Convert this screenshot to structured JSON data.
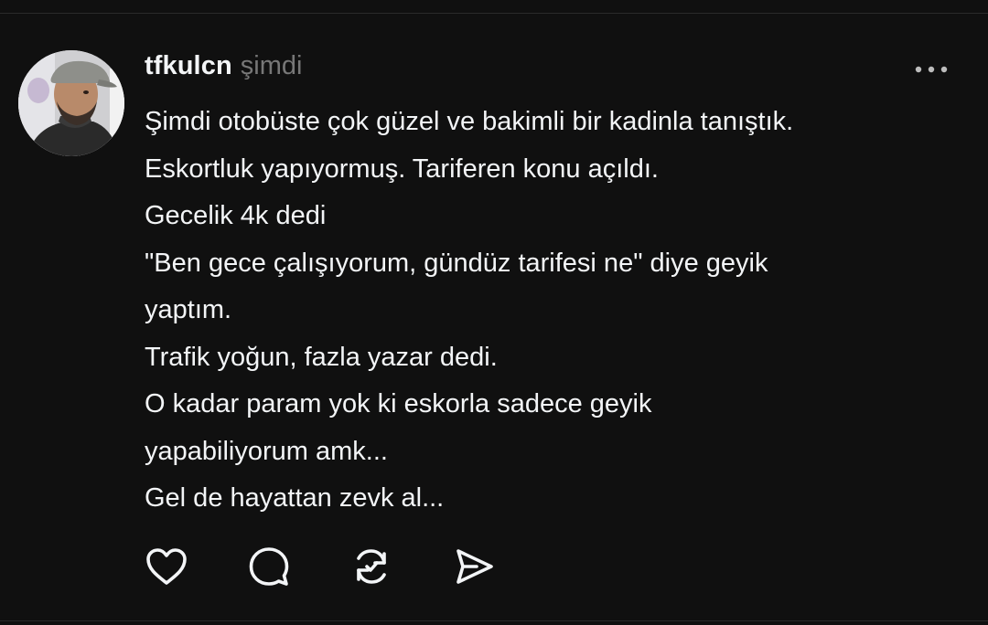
{
  "post": {
    "username": "tfkulcn",
    "timestamp": "şimdi",
    "lines": [
      "Şimdi otobüste çok güzel ve bakimli bir kadinla tanıştık.",
      "Eskortluk yapıyormuş. Tariferen konu açıldı.",
      "Gecelik 4k dedi",
      "\"Ben gece çalışıyorum, gündüz tarifesi ne\" diye geyik",
      "yaptım.",
      "Trafik yoğun, fazla yazar dedi.",
      "O kadar param yok ki eskorla sadece geyik",
      "yapabiliyorum amk...",
      "Gel de hayattan zevk al..."
    ]
  },
  "icons": {
    "more": "more-horizontal-icon",
    "like": "heart-icon",
    "reply": "comment-icon",
    "repost": "repost-icon",
    "share": "send-icon"
  },
  "colors": {
    "background": "#101010",
    "text": "#f3f5f7",
    "muted": "#777777",
    "icon": "#f3f5f7"
  }
}
